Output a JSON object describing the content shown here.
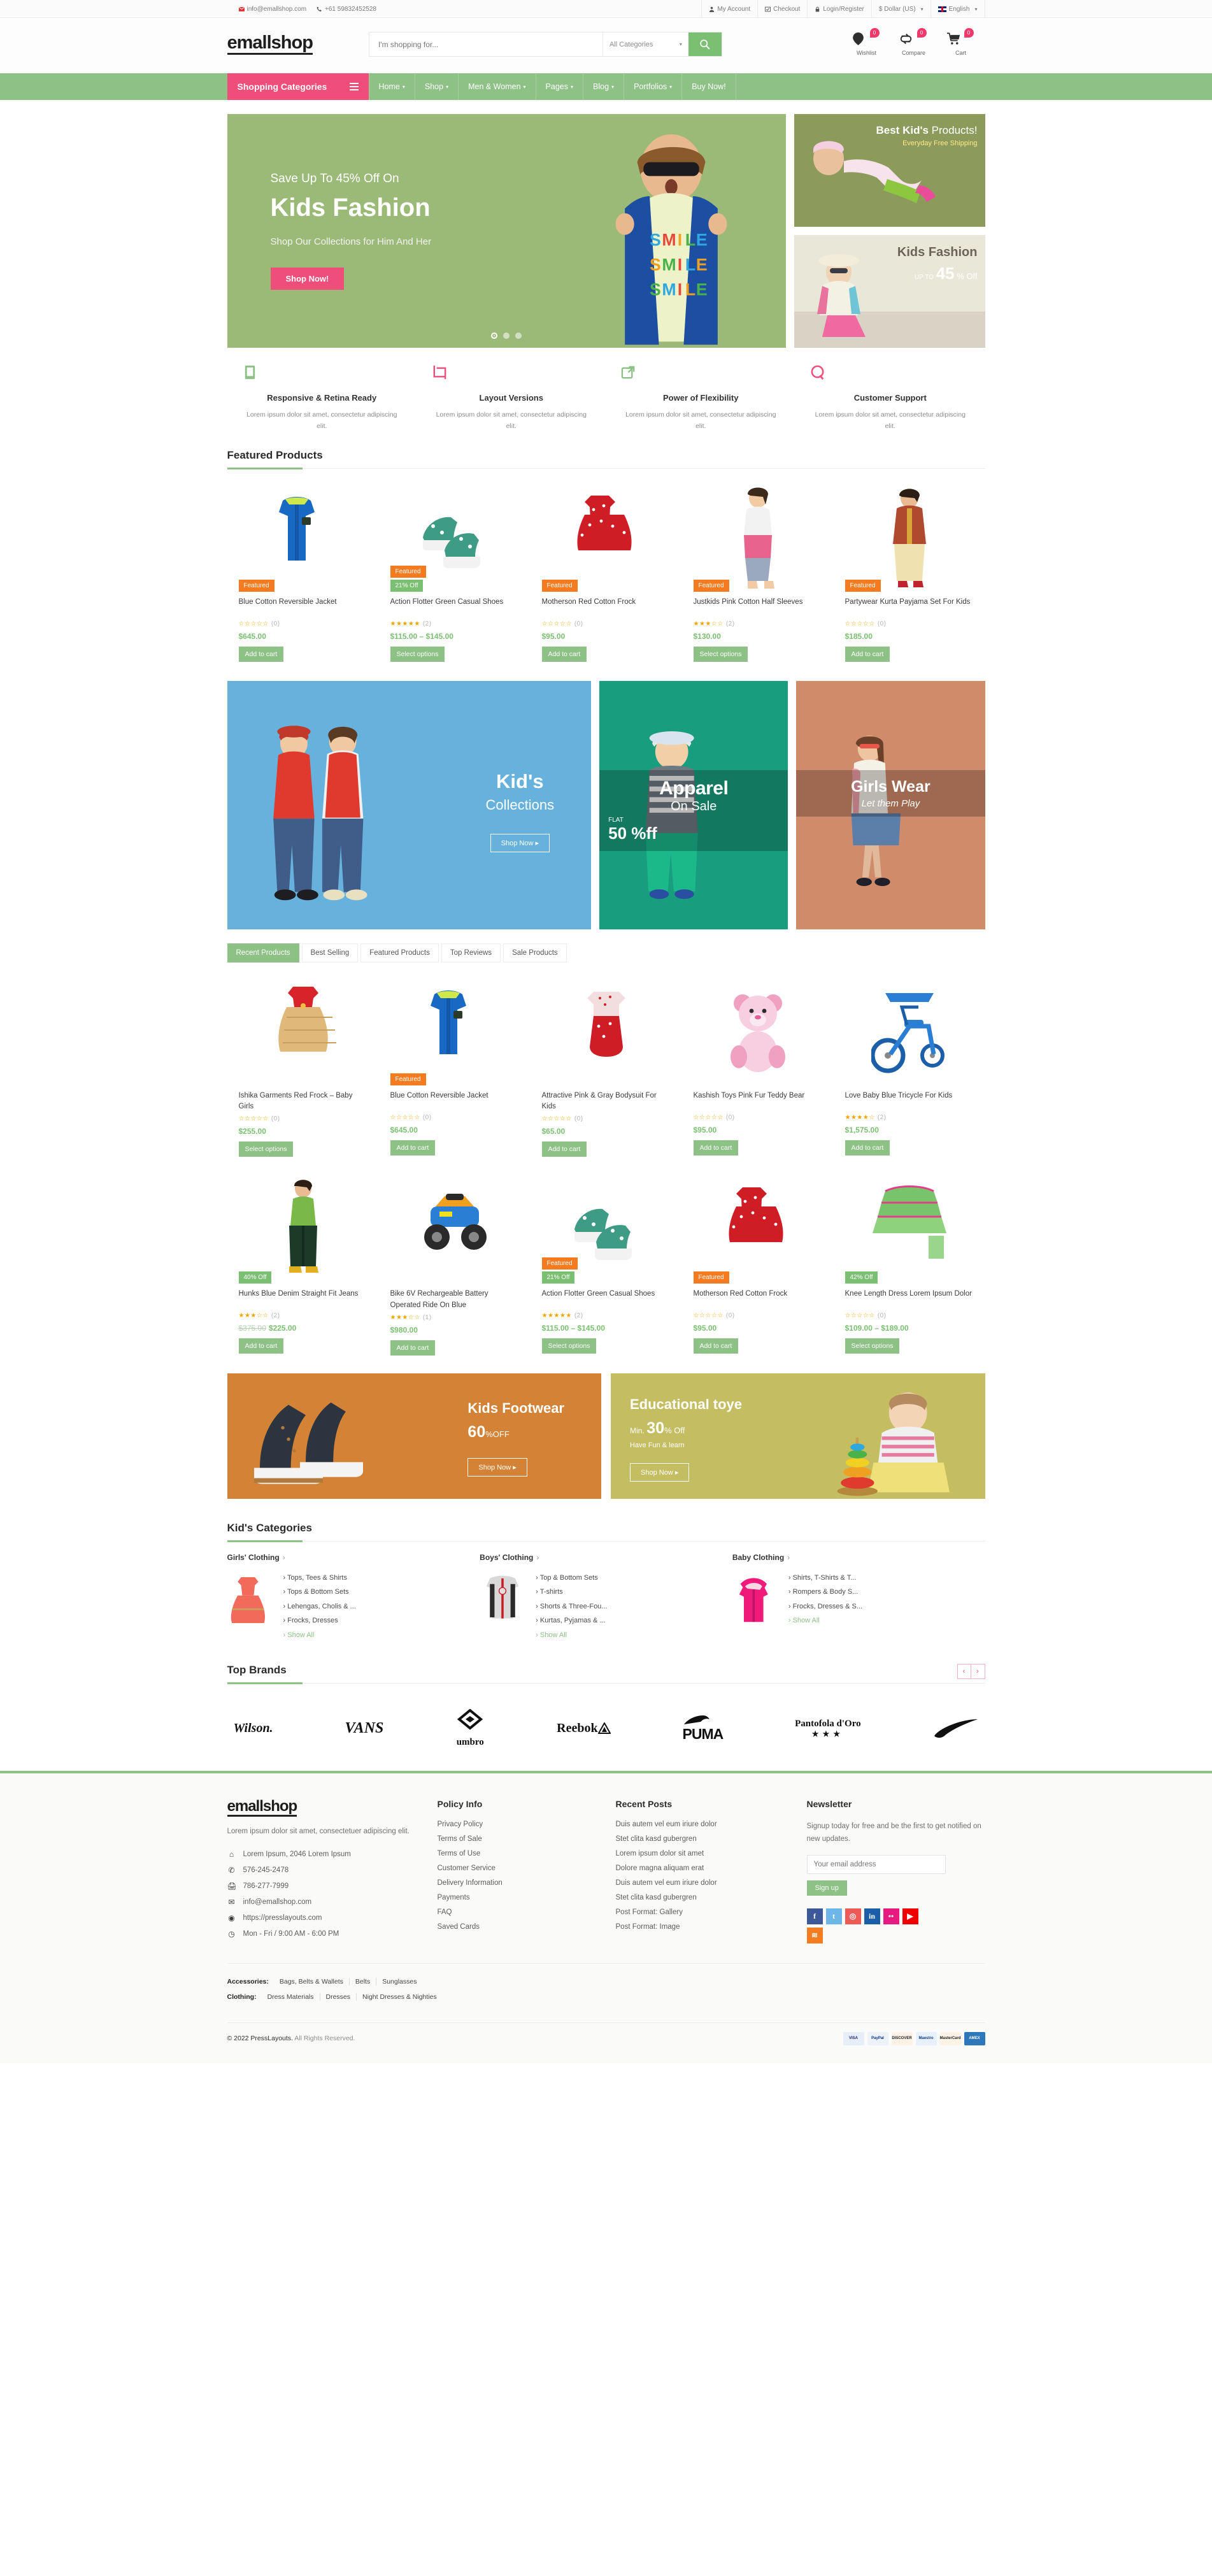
{
  "topbar": {
    "email": "info@emallshop.com",
    "phone": "+61 59832452528",
    "links": [
      {
        "label": "My Account",
        "icon": "user-icon"
      },
      {
        "label": "Checkout",
        "icon": "checkout-icon"
      },
      {
        "label": "Login/Register",
        "icon": "lock-icon"
      }
    ],
    "currency": "$ Dollar (US)",
    "language": "English"
  },
  "header": {
    "logo": "emallshop",
    "search_placeholder": "I'm shopping for...",
    "search_value": "",
    "category_selected": "All Categories",
    "icons": [
      {
        "label": "Wishlist",
        "count": "0",
        "icon": "heart-pin-icon"
      },
      {
        "label": "Compare",
        "count": "0",
        "icon": "compare-icon"
      },
      {
        "label": "Cart",
        "count": "0",
        "icon": "cart-icon"
      }
    ]
  },
  "nav": {
    "shopping_categories": "Shopping Categories",
    "links": [
      {
        "label": "Home",
        "caret": true
      },
      {
        "label": "Shop",
        "caret": true
      },
      {
        "label": "Men & Women",
        "caret": true
      },
      {
        "label": "Pages",
        "caret": true
      },
      {
        "label": "Blog",
        "caret": true
      },
      {
        "label": "Portfolios",
        "caret": true
      },
      {
        "label": "Buy Now!",
        "caret": false
      }
    ]
  },
  "hero": {
    "slide": {
      "subtitle": "Save Up To 45% Off On",
      "title": "Kids Fashion",
      "description": "Shop Our Collections for Him And Her",
      "button": "Shop Now!"
    },
    "side_banners": [
      {
        "title_bold": "Best Kid's",
        "title_light": " Products!",
        "sub": "Everyday Free Shipping"
      },
      {
        "title": "Kids Fashion",
        "upto": "UP TO",
        "percent": "45",
        "off": "% Off"
      }
    ]
  },
  "features": [
    {
      "icon": "tablet-icon",
      "color": "#8dc185",
      "title": "Responsive & Retina Ready",
      "desc": "Lorem ipsum dolor sit amet, consectetur adipiscing elit."
    },
    {
      "icon": "crop-icon",
      "color": "#ef4e7b",
      "title": "Layout Versions",
      "desc": "Lorem ipsum dolor sit amet, consectetur adipiscing elit."
    },
    {
      "icon": "external-link-icon",
      "color": "#8dc185",
      "title": "Power of Flexibility",
      "desc": "Lorem ipsum dolor sit amet, consectetur adipiscing elit."
    },
    {
      "icon": "chat-icon",
      "color": "#ef4e7b",
      "title": "Customer Support",
      "desc": "Lorem ipsum dolor sit amet, consectetur adipiscing elit."
    }
  ],
  "featured_section": {
    "title": "Featured Products",
    "products": [
      {
        "name": "Blue Cotton Reversible Jacket",
        "badge_featured": "Featured",
        "badge_sale": "",
        "rating": 0,
        "reviews": "(0)",
        "price": "$645.00",
        "old_price": "",
        "button": "Add to cart",
        "img": "blue-jacket"
      },
      {
        "name": "Action Flotter Green Casual Shoes",
        "badge_featured": "Featured",
        "badge_sale": "21% Off",
        "rating": 5,
        "reviews": "(2)",
        "price": "$115.00 – $145.00",
        "old_price": "",
        "button": "Select options",
        "img": "green-shoes"
      },
      {
        "name": "Motherson Red Cotton Frock",
        "badge_featured": "Featured",
        "badge_sale": "",
        "rating": 0,
        "reviews": "(0)",
        "price": "$95.00",
        "old_price": "",
        "button": "Add to cart",
        "img": "red-frock"
      },
      {
        "name": "Justkids Pink Cotton Half Sleeves",
        "badge_featured": "Featured",
        "badge_sale": "",
        "rating": 3,
        "reviews": "(2)",
        "price": "$130.00",
        "old_price": "",
        "button": "Select options",
        "img": "pink-girl"
      },
      {
        "name": "Partywear Kurta Payjama Set For Kids",
        "badge_featured": "Featured",
        "badge_sale": "",
        "rating": 0,
        "reviews": "(0)",
        "price": "$185.00",
        "old_price": "",
        "button": "Add to cart",
        "img": "kurta-boy"
      }
    ]
  },
  "mid_banners": {
    "left": {
      "title": "Kid's",
      "subtitle": "Collections",
      "button": "Shop Now"
    },
    "center": {
      "title": "Apparel",
      "subtitle": "On Sale",
      "flat": "FLAT",
      "discount": "50 %ff"
    },
    "right": {
      "title": "Girls Wear",
      "subtitle": "Let them Play"
    }
  },
  "tabs": [
    {
      "label": "Recent Products",
      "active": true
    },
    {
      "label": "Best Selling",
      "active": false
    },
    {
      "label": "Featured Products",
      "active": false
    },
    {
      "label": "Top Reviews",
      "active": false
    },
    {
      "label": "Sale Products",
      "active": false
    }
  ],
  "recent_products_row1": [
    {
      "name": "Ishika Garments Red Frock – Baby Girls",
      "badge_featured": "",
      "badge_sale": "",
      "rating": 0,
      "reviews": "(0)",
      "price": "$255.00",
      "old_price": "",
      "button": "Select options",
      "img": "red-dress"
    },
    {
      "name": "Blue Cotton Reversible Jacket",
      "badge_featured": "Featured",
      "badge_sale": "",
      "rating": 0,
      "reviews": "(0)",
      "price": "$645.00",
      "old_price": "",
      "button": "Add to cart",
      "img": "blue-jacket"
    },
    {
      "name": "Attractive Pink & Gray Bodysuit For Kids",
      "badge_featured": "",
      "badge_sale": "",
      "rating": 0,
      "reviews": "(0)",
      "price": "$65.00",
      "old_price": "",
      "button": "Add to cart",
      "img": "bodysuit"
    },
    {
      "name": "Kashish Toys Pink Fur Teddy Bear",
      "badge_featured": "",
      "badge_sale": "",
      "rating": 0,
      "reviews": "(0)",
      "price": "$95.00",
      "old_price": "",
      "button": "Add to cart",
      "img": "teddy"
    },
    {
      "name": "Love Baby Blue Tricycle For Kids",
      "badge_featured": "",
      "badge_sale": "",
      "rating": 4,
      "reviews": "(2)",
      "price": "$1,575.00",
      "old_price": "",
      "button": "Add to cart",
      "img": "tricycle"
    }
  ],
  "recent_products_row2": [
    {
      "name": "Hunks Blue Denim Straight Fit Jeans",
      "badge_featured": "",
      "badge_sale": "40% Off",
      "rating": 3,
      "reviews": "(2)",
      "price": "$225.00",
      "old_price": "$375.00",
      "button": "Add to cart",
      "img": "jeans-boy"
    },
    {
      "name": "Bike 6V Rechargeable Battery Operated Ride On Blue",
      "badge_featured": "",
      "badge_sale": "",
      "rating": 3,
      "reviews": "(1)",
      "price": "$980.00",
      "old_price": "",
      "button": "Add to cart",
      "img": "quad-bike"
    },
    {
      "name": "Action Flotter Green Casual Shoes",
      "badge_featured": "Featured",
      "badge_sale": "21% Off",
      "rating": 5,
      "reviews": "(2)",
      "price": "$115.00 – $145.00",
      "old_price": "",
      "button": "Select options",
      "img": "green-shoes"
    },
    {
      "name": "Motherson Red Cotton Frock",
      "badge_featured": "Featured",
      "badge_sale": "",
      "rating": 0,
      "reviews": "(0)",
      "price": "$95.00",
      "old_price": "",
      "button": "Add to cart",
      "img": "red-frock"
    },
    {
      "name": "Knee Length Dress Lorem Ipsum Dolor",
      "badge_featured": "",
      "badge_sale": "42% Off",
      "rating": 0,
      "reviews": "(0)",
      "price": "$109.00 – $189.00",
      "old_price": "",
      "button": "Select options",
      "img": "green-dress"
    }
  ],
  "promos": [
    {
      "title": "Kids Footwear",
      "percent": "60",
      "off": "OFF",
      "sub": "",
      "button": "Shop Now"
    },
    {
      "title": "Educational toye",
      "min": "Min.",
      "percent": "30",
      "off": "% Off",
      "sub": "Have Fun & learn",
      "button": "Shop Now"
    }
  ],
  "categories_section": {
    "title": "Kid's Categories",
    "columns": [
      {
        "head": "Girls' Clothing",
        "items": [
          "Tops, Tees & Shirts",
          "Tops & Bottom Sets",
          "Lehengas, Cholis & ...",
          "Frocks, Dresses"
        ],
        "show_all": "Show All",
        "img": "girl-dress"
      },
      {
        "head": "Boys' Clothing",
        "items": [
          "Top & Bottom Sets",
          "T-shirts",
          "Shorts & Three-Fou...",
          "Kurtas, Pyjamas & ..."
        ],
        "show_all": "Show All",
        "img": "boy-jacket"
      },
      {
        "head": "Baby Clothing",
        "items": [
          "Shirts, T-Shirts & T...",
          "Rompers & Body S...",
          "Frocks, Dresses & S..."
        ],
        "show_all": "Show All",
        "img": "baby-jacket"
      }
    ]
  },
  "brands_section": {
    "title": "Top Brands",
    "brands": [
      "Wilson.",
      "VANS",
      "umbro",
      "Reebok",
      "PUMA",
      "Pantofola d'Oro",
      "Nike"
    ]
  },
  "footer": {
    "logo": "emallshop",
    "desc": "Lorem ipsum dolor sit amet, consectetuer adipiscing elit.",
    "contact": [
      {
        "icon": "home-icon",
        "text": "Lorem Ipsum, 2046 Lorem Ipsum"
      },
      {
        "icon": "phone-icon",
        "text": "576-245-2478"
      },
      {
        "icon": "fax-icon",
        "text": "786-277-7999"
      },
      {
        "icon": "mail-icon",
        "text": "info@emallshop.com"
      },
      {
        "icon": "globe-icon",
        "text": "https://presslayouts.com"
      },
      {
        "icon": "clock-icon",
        "text": "Mon - Fri / 9:00 AM - 6:00 PM"
      }
    ],
    "policy": {
      "head": "Policy Info",
      "items": [
        "Privacy Policy",
        "Terms of Sale",
        "Terms of Use",
        "Customer Service",
        "Delivery Information",
        "Payments",
        "FAQ",
        "Saved Cards"
      ]
    },
    "recent": {
      "head": "Recent Posts",
      "items": [
        "Duis autem vel eum iriure dolor",
        "Stet clita kasd gubergren",
        "Lorem ipsum dolor sit amet",
        "Dolore magna aliquam erat",
        "Duis autem vel eum iriure dolor",
        "Stet clita kasd gubergren",
        "Post Format: Gallery",
        "Post Format: Image"
      ]
    },
    "newsletter": {
      "head": "Newsletter",
      "desc": "Signup today for free and be the first to get notified on new updates.",
      "placeholder": "Your email address",
      "value": "",
      "button": "Sign up"
    },
    "socials": [
      {
        "name": "facebook-icon",
        "glyph": "f",
        "color": "#3b5998"
      },
      {
        "name": "twitter-icon",
        "glyph": "t",
        "color": "#6cb7e8"
      },
      {
        "name": "instagram-icon",
        "glyph": "◎",
        "color": "#ee5a56"
      },
      {
        "name": "linkedin-icon",
        "glyph": "in",
        "color": "#1a5fa8"
      },
      {
        "name": "flickr-icon",
        "glyph": "••",
        "color": "#e61a80"
      },
      {
        "name": "youtube-icon",
        "glyph": "▶",
        "color": "#f10000"
      },
      {
        "name": "rss-icon",
        "glyph": "≋",
        "color": "#f57c20"
      }
    ],
    "tags": [
      {
        "label": "Accessories:",
        "items": [
          "Bags, Belts & Wallets",
          "Belts",
          "Sunglasses"
        ]
      },
      {
        "label": "Clothing:",
        "items": [
          "Dress Materials",
          "Dresses",
          "Night Dresses & Nighties"
        ]
      }
    ],
    "copyright_main": "© 2022 PressLayouts.",
    "copyright_sub": " All Rights Reserved.",
    "cards": [
      {
        "name": "VISA",
        "color": "#e8eef7",
        "text": "#1a1f71"
      },
      {
        "name": "PayPal",
        "color": "#eef2f8",
        "text": "#003087"
      },
      {
        "name": "DISCOVER",
        "color": "#fff3e8",
        "text": "#1a1a1a"
      },
      {
        "name": "Maestro",
        "color": "#e8f0fb",
        "text": "#0a3a82"
      },
      {
        "name": "MasterCard",
        "color": "#fdf3e6",
        "text": "#1a1a1a"
      },
      {
        "name": "AMEX",
        "color": "#2e77bb",
        "text": "#ffffff"
      }
    ]
  },
  "colors": {
    "green": "#8dc185",
    "pink": "#ef4e7b",
    "orange": "#f47b20"
  }
}
